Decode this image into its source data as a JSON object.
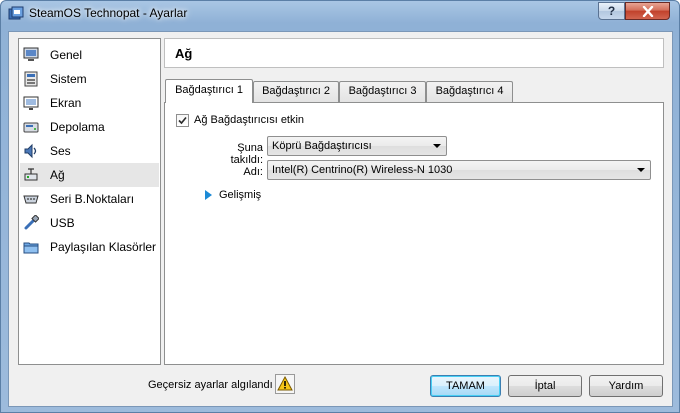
{
  "window": {
    "title": "SteamOS Technopat - Ayarlar",
    "help_label": "?",
    "close_label": "X"
  },
  "sidebar": {
    "items": [
      {
        "label": "Genel",
        "icon": "monitor-icon"
      },
      {
        "label": "Sistem",
        "icon": "chip-icon"
      },
      {
        "label": "Ekran",
        "icon": "display-icon"
      },
      {
        "label": "Depolama",
        "icon": "disk-icon"
      },
      {
        "label": "Ses",
        "icon": "speaker-icon"
      },
      {
        "label": "Ağ",
        "icon": "network-icon",
        "selected": true
      },
      {
        "label": "Seri B.Noktaları",
        "icon": "serial-port-icon"
      },
      {
        "label": "USB",
        "icon": "usb-icon"
      },
      {
        "label": "Paylaşılan Klasörler",
        "icon": "folder-icon"
      }
    ]
  },
  "main": {
    "heading": "Ağ",
    "tabs": [
      {
        "label": "Bağdaştırıcı 1",
        "active": true
      },
      {
        "label": "Bağdaştırıcı 2"
      },
      {
        "label": "Bağdaştırıcı 3"
      },
      {
        "label": "Bağdaştırıcı 4"
      }
    ],
    "enable_checkbox": {
      "label": "Ağ Bağdaştırıcısı etkin",
      "checked": true
    },
    "attached_to": {
      "label": "Şuna takıldı:",
      "value": "Köprü Bağdaştırıcısı"
    },
    "name": {
      "label": "Adı:",
      "value": "Intel(R) Centrino(R) Wireless-N 1030"
    },
    "advanced": {
      "label": "Gelişmiş"
    }
  },
  "footer": {
    "warning_text": "Geçersiz ayarlar algılandı",
    "warning_icon": "warning-icon",
    "buttons": {
      "ok": "TAMAM",
      "cancel": "İptal",
      "help": "Yardım"
    }
  },
  "colors": {
    "accent_blue": "#1c8ad6",
    "title_bar": "#9dbbdc",
    "selected_item": "#e6e6e6"
  }
}
